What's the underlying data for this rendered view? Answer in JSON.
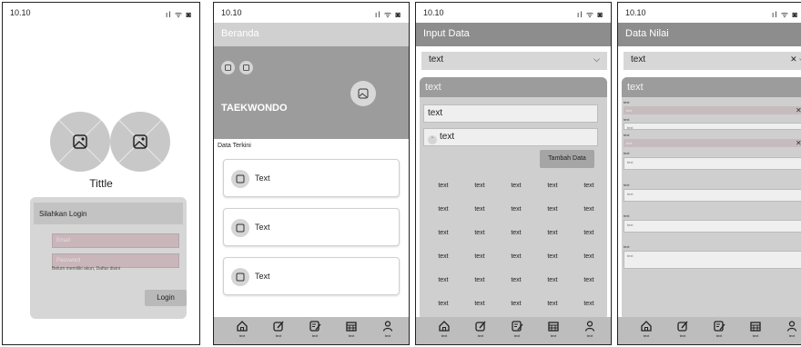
{
  "status": {
    "time": "10.10",
    "signal_label": "ıl ᯤ ◙"
  },
  "screen1": {
    "title": "Tittle",
    "login": {
      "heading": "Silahkan Login",
      "email_placeholder": "Email",
      "password_placeholder": "Password",
      "hint": "Belum memiliki akun, Daftar disini",
      "button": "Login"
    }
  },
  "screen2": {
    "appbar_title": "Beranda",
    "banner_title": "TAEKWONDO",
    "section_title": "Data Terkini",
    "cards": [
      {
        "label": "Text"
      },
      {
        "label": "Text"
      },
      {
        "label": "Text"
      }
    ]
  },
  "screen3": {
    "appbar_title": "Input Data",
    "dropdown_value": "text",
    "panel_title": "text",
    "field1": "text",
    "field2": "text",
    "button": "Tambah Data",
    "grid": [
      [
        "text",
        "text",
        "text",
        "text",
        "text"
      ],
      [
        "text",
        "text",
        "text",
        "text",
        "text"
      ],
      [
        "text",
        "text",
        "text",
        "text",
        "text"
      ],
      [
        "text",
        "text",
        "text",
        "text",
        "text"
      ],
      [
        "text",
        "text",
        "text",
        "text",
        "text"
      ],
      [
        "text",
        "text",
        "text",
        "text",
        "text"
      ]
    ]
  },
  "screen4": {
    "appbar_title": "Data Nilai",
    "dropdown_value": "text",
    "panel_title": "text",
    "label": "text",
    "select_value": "text",
    "input_value": "text"
  },
  "nav": {
    "items": [
      {
        "icon": "home-icon",
        "label": "text"
      },
      {
        "icon": "edit-icon",
        "label": "text"
      },
      {
        "icon": "note-edit-icon",
        "label": "text"
      },
      {
        "icon": "calendar-icon",
        "label": "text"
      },
      {
        "icon": "person-icon",
        "label": "text"
      }
    ]
  },
  "colors": {
    "appbar": "#8d8d8d",
    "panel": "#cfcfcf",
    "navbar": "#bdbdbd",
    "pink_field": "#c8b6bb"
  }
}
